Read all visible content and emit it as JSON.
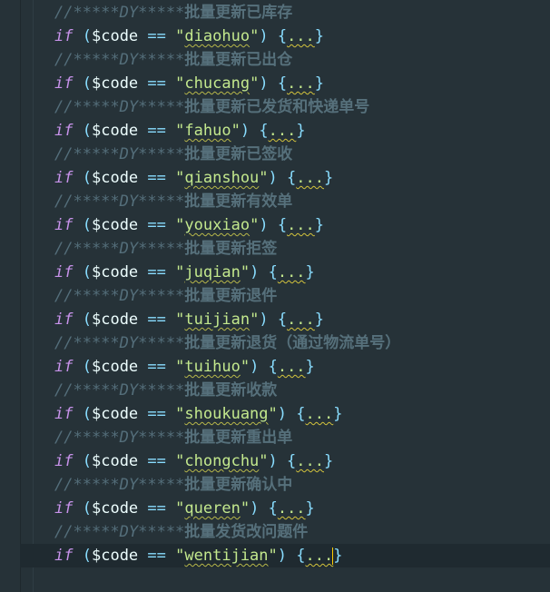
{
  "editor": {
    "comment_prefix": "//*****DY*****",
    "keyword": "if",
    "variable": "$code",
    "operator": "==",
    "fold_placeholder": "...",
    "blocks": [
      {
        "comment": "批量更新已库存",
        "code": "diaohuo"
      },
      {
        "comment": "批量更新已出仓",
        "code": "chucang"
      },
      {
        "comment": "批量更新已发货和快递单号",
        "code": "fahuo"
      },
      {
        "comment": "批量更新已签收",
        "code": "qianshou"
      },
      {
        "comment": "批量更新有效单",
        "code": "youxiao"
      },
      {
        "comment": "批量更新拒签",
        "code": "juqian"
      },
      {
        "comment": "批量更新退件",
        "code": "tuijian"
      },
      {
        "comment": "批量更新退货（通过物流单号）",
        "code": "tuihuo"
      },
      {
        "comment": "批量更新收款",
        "code": "shoukuang"
      },
      {
        "comment": "批量更新重出单",
        "code": "chongchu"
      },
      {
        "comment": "批量更新确认中",
        "code": "queren"
      },
      {
        "comment": "批量发货改问题件",
        "code": "wentijian"
      }
    ]
  },
  "colors": {
    "background": "#263238",
    "comment": "#546e7a",
    "keyword": "#c792ea",
    "string": "#c3e88d",
    "punctuation": "#89ddff",
    "variable": "#eeffff"
  }
}
